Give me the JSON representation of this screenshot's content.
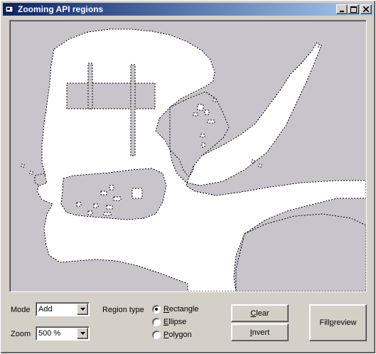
{
  "window": {
    "title": "Zooming API regions",
    "minimize_glyph": "_",
    "maximize_glyph": "□",
    "close_glyph": "×"
  },
  "controls": {
    "mode_label": "Mode",
    "mode_value": "Add",
    "zoom_label": "Zoom",
    "zoom_value": "500 %",
    "region_type_label": "Region type",
    "region_options": [
      {
        "label": "Rectangle",
        "accel": "R",
        "rest": "ectangle",
        "selected": true
      },
      {
        "label": "Ellipse",
        "accel": "E",
        "rest": "llipse",
        "selected": false
      },
      {
        "label": "Polygon",
        "accel": "P",
        "rest": "olygon",
        "selected": false
      }
    ],
    "clear_button": {
      "label": "Clear",
      "accel": "C",
      "rest": "lear"
    },
    "invert_button": {
      "label": "Invert",
      "accel": "I",
      "rest": "nvert"
    },
    "fill_preview_button": {
      "label": "Fill preview",
      "pre": "Fill ",
      "accel": "p",
      "rest": "review"
    }
  },
  "colors": {
    "region_fill": "#ffffff",
    "background": "#c8c4cc",
    "title_gradient_start": "#0a246a",
    "title_gradient_end": "#a6caf0"
  }
}
